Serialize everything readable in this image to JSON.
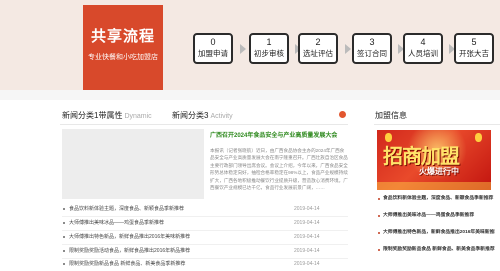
{
  "process": {
    "title": "共享流程",
    "subtitle": "专业快餐和小吃加盟店",
    "steps": [
      {
        "num": "0",
        "label": "加盟申请"
      },
      {
        "num": "1",
        "label": "初步审核"
      },
      {
        "num": "2",
        "label": "选址评估"
      },
      {
        "num": "3",
        "label": "签订合同"
      },
      {
        "num": "4",
        "label": "人员培训"
      },
      {
        "num": "5",
        "label": "开张大吉"
      }
    ]
  },
  "news": {
    "tabs": [
      {
        "label": "新闻分类1带属性",
        "en": "Dynamic"
      },
      {
        "label": "新闻分类3",
        "en": "Activity"
      }
    ],
    "feature": {
      "title": "广西召开2024年食品安全与产业高质量发展大会",
      "body": "本报讯（记者张晓航）近日，由广西食品协会主办的2024年广西食品安全与产业高质量发展大会在南宁隆重召开。广西壮族自治区食品主要行政部门领导出席会议。会议上介绍，今年以来，广西食品安全形势总体稳定向好，抽检合格率稳定在98%以上，食品产业规模持续扩大，广西各地积极推动餐饮行业提质升级，营造放心消费环境。广西餐饮产业规模已达千亿，食品行业发展前景广阔，……"
    },
    "items": [
      {
        "title": "食品饮料新体验主题，深度食品、新颖食品季新推荐",
        "date": "2019-04-14"
      },
      {
        "title": "大师傅推出美味冰品——鸡蛋食品季新推荐",
        "date": "2019-04-14"
      },
      {
        "title": "大师傅推出特色新品，新鲜食品推出2016年美味新推荐",
        "date": "2019-04-14"
      },
      {
        "title": "限制奖励奖励活动食品，新鲜食品推出2016年新品推荐",
        "date": "2019-04-14"
      },
      {
        "title": "限制奖励奖励新品食品 新鲜食品、新美食品季新推荐",
        "date": "2019-04-14"
      }
    ]
  },
  "sidebar": {
    "title": "加盟信息",
    "banner": {
      "big": "招商加盟",
      "small": "火爆进行中"
    },
    "items": [
      {
        "title": "食品饮料新体验主题，深度食品、新颖食品季新推荐"
      },
      {
        "title": "大师傅推出美味冰品——鸡蛋食品季新推荐"
      },
      {
        "title": "大师傅推出特色新品，新鲜食品推出2016年美味新推荐"
      },
      {
        "title": "限制奖励奖励新品食品 新鲜食品、新美食品季新推荐"
      }
    ]
  },
  "colors": {
    "accent": "#d8492b",
    "band": "#f4e9e3",
    "feature_title": "#2f8a1f"
  }
}
